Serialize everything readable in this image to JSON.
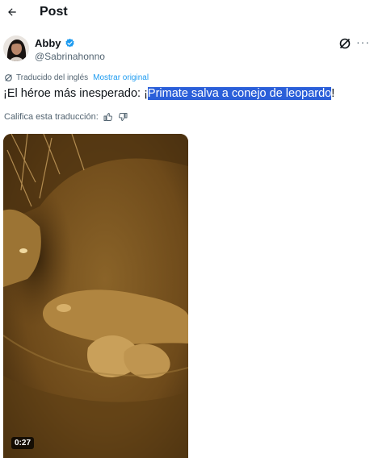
{
  "header": {
    "title": "Post",
    "back_icon": "arrow-left-icon"
  },
  "author": {
    "name": "Abby",
    "handle": "@Sabrinahonno",
    "verified": true,
    "verified_color": "#1d9bf0"
  },
  "translation": {
    "label": "Traducido del inglés",
    "show_original": "Mostrar original",
    "rate_label": "Califica esta traducción:"
  },
  "tweet": {
    "text_before": "¡El héroe más inesperado: ¡",
    "text_highlight": "Primate salva a conejo de leopardo",
    "text_after": "!"
  },
  "media": {
    "duration": "0:27"
  },
  "colors": {
    "accent": "#1d9bf0",
    "highlight": "#2b5fd9",
    "secondary_text": "#536471"
  }
}
